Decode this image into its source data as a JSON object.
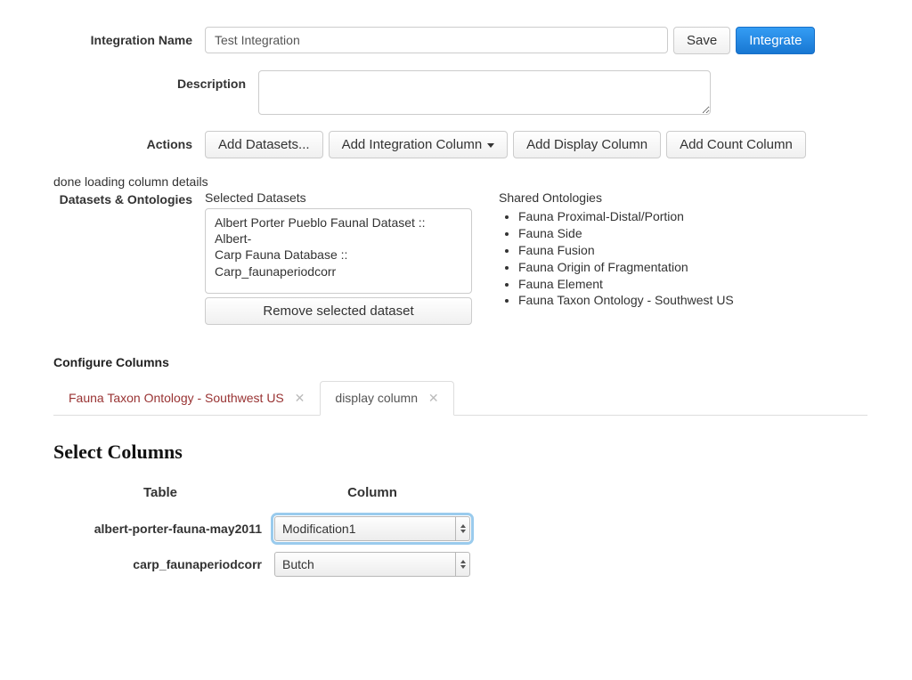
{
  "form": {
    "integration_name_label": "Integration Name",
    "integration_name_value": "Test Integration",
    "save_label": "Save",
    "integrate_label": "Integrate",
    "description_label": "Description",
    "description_value": "",
    "actions_label": "Actions",
    "add_datasets_label": "Add Datasets...",
    "add_integration_column_label": "Add Integration Column",
    "add_display_column_label": "Add Display Column",
    "add_count_column_label": "Add Count Column"
  },
  "status_text": "done loading column details",
  "datasets_section": {
    "label": "Datasets & Ontologies",
    "selected_heading": "Selected Datasets",
    "selected_items": [
      "Albert Porter Pueblo Faunal Dataset :: Albert-",
      "Carp Fauna Database :: Carp_faunaperiodcorr"
    ],
    "remove_label": "Remove selected dataset",
    "shared_heading": "Shared Ontologies",
    "ontologies": [
      "Fauna Proximal-Distal/Portion",
      "Fauna Side",
      "Fauna Fusion",
      "Fauna Origin of Fragmentation",
      "Fauna Element",
      "Fauna Taxon Ontology - Southwest US"
    ]
  },
  "configure": {
    "heading": "Configure Columns",
    "tabs": [
      {
        "label": "Fauna Taxon Ontology - Southwest US",
        "active": false
      },
      {
        "label": "display column",
        "active": true
      }
    ]
  },
  "select_columns": {
    "heading": "Select Columns",
    "table_header": "Table",
    "column_header": "Column",
    "rows": [
      {
        "table": "albert-porter-fauna-may2011",
        "column": "Modification1",
        "focused": true
      },
      {
        "table": "carp_faunaperiodcorr",
        "column": "Butch",
        "focused": false
      }
    ]
  }
}
